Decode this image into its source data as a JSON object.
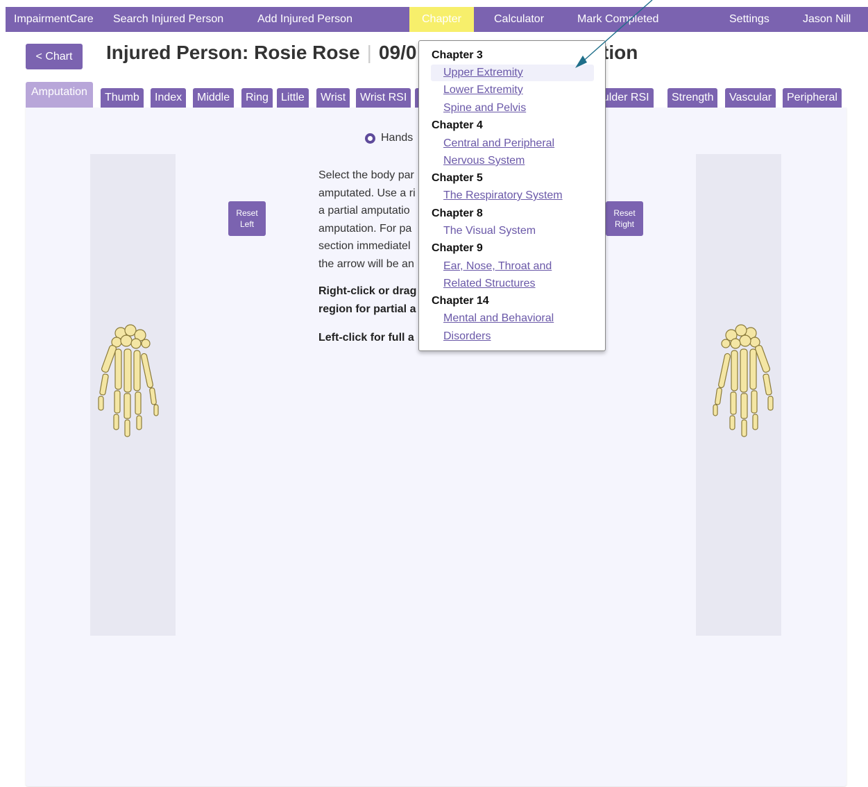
{
  "nav": {
    "brand": "ImpairmentCare",
    "search": "Search Injured Person",
    "add": "Add Injured Person",
    "chapter": "Chapter",
    "calculator": "Calculator",
    "mark_completed": "Mark Completed",
    "settings": "Settings",
    "user": "Jason Nill"
  },
  "header": {
    "chart_button": "< Chart",
    "title": "Injured Person: Rosie Rose",
    "date_partial": "09/0",
    "title_tail": "tion"
  },
  "tabs": [
    "Amputation",
    "Thumb",
    "Index",
    "Middle",
    "Ring",
    "Little",
    "Wrist",
    "Wrist RSI",
    "oulder RSI",
    "Strength",
    "Vascular",
    "Peripheral"
  ],
  "content": {
    "radio_label": "Hands",
    "reset_left": [
      "Reset",
      "Left"
    ],
    "reset_right": [
      "Reset",
      "Right"
    ],
    "instructions": [
      "Select the body par",
      "amputated. Use a ri",
      "a partial amputatio",
      "amputation. For pa",
      "section immediatel",
      "the arrow will be an"
    ],
    "bold1": [
      "Right-click or drag",
      "region for partial a"
    ],
    "bold2": "Left-click for full a"
  },
  "dropdown": {
    "groups": [
      {
        "heading": "Chapter 3",
        "links": [
          "Upper Extremity",
          "Lower Extremity",
          "Spine and Pelvis"
        ]
      },
      {
        "heading": "Chapter 4",
        "links": [
          "Central and Peripheral",
          "Nervous System"
        ]
      },
      {
        "heading": "Chapter 5",
        "links": [
          "The Respiratory System"
        ]
      },
      {
        "heading": "Chapter 8",
        "links": [
          "The Visual System"
        ]
      },
      {
        "heading": "Chapter 9",
        "links": [
          "Ear, Nose, Throat and",
          "Related Structures"
        ]
      },
      {
        "heading": "Chapter 14",
        "links": [
          "Mental and Behavioral",
          "Disorders"
        ]
      }
    ]
  },
  "colors": {
    "brand": "#7b63b0",
    "highlight": "#f7ef6b",
    "link": "#6a58a8",
    "arrow": "#1f6f8a",
    "bone": "#f4e6a4"
  }
}
